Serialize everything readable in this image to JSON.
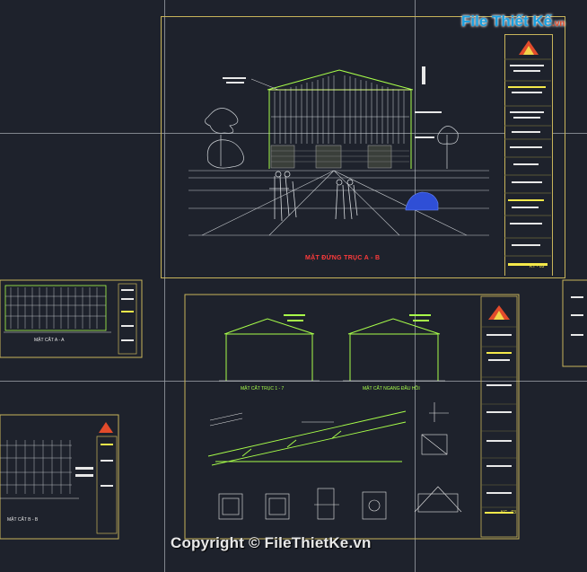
{
  "watermark": {
    "logo_text": "File Thiết Kế",
    "logo_suffix": ".vn",
    "copyright": "Copyright © FileThietKe.vn"
  },
  "drawings": {
    "main_elevation_label": "MẶT ĐỨNG TRỤC A - B",
    "left_elevation_label": "MẶT CẮT A - A",
    "section_1_label": "MẶT CẮT TRỤC 1 - 7",
    "section_2_label": "MẶT CẮT NGANG ĐẦU HỒI",
    "bottom_left_label": "MẶT CẮT B - B",
    "sheet_code_1": "KT - 03",
    "sheet_code_2": "KC - 03"
  },
  "colors": {
    "background": "#1e222c",
    "sheet_border": "#c8b45a",
    "building_line": "#a8ff4a",
    "title_red": "#ff3b3b",
    "accent_yellow": "#f4e84a"
  }
}
